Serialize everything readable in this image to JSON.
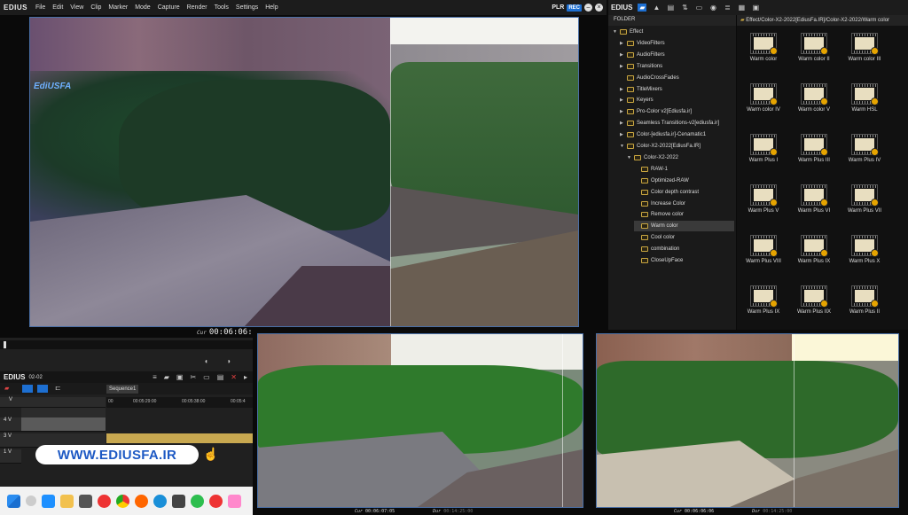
{
  "menubar": {
    "logo": "EDIUS",
    "menus": [
      "File",
      "Edit",
      "View",
      "Clip",
      "Marker",
      "Mode",
      "Capture",
      "Render",
      "Tools",
      "Settings",
      "Help"
    ],
    "plr": "PLR",
    "rec": "REC"
  },
  "preview": {
    "watermark": "EdiUSFA",
    "cur_label": "Cur",
    "cur_time": "00:06:06:"
  },
  "bin": {
    "logo": "EDIUS",
    "folder_label": "FOLDER",
    "path": "Effect/Color-X2-2022[EdiusFa.IR]/Color-X2-2022/Warm color",
    "tree": [
      {
        "label": "Effect",
        "level": 0,
        "arrow": "▼"
      },
      {
        "label": "VideoFilters",
        "level": 1,
        "arrow": "▶"
      },
      {
        "label": "AudioFilters",
        "level": 1,
        "arrow": "▶"
      },
      {
        "label": "Transitions",
        "level": 1,
        "arrow": "▶"
      },
      {
        "label": "AudioCrossFades",
        "level": 1,
        "arrow": ""
      },
      {
        "label": "TitleMixers",
        "level": 1,
        "arrow": "▶"
      },
      {
        "label": "Keyers",
        "level": 1,
        "arrow": "▶"
      },
      {
        "label": "Pro-Color v2[Ediusfa.ir]",
        "level": 1,
        "arrow": "▶"
      },
      {
        "label": "Seamless Transitions-v2[ediusfa.ir]",
        "level": 1,
        "arrow": "▶"
      },
      {
        "label": "Color-[ediusfa.ir]-Cenamatic1",
        "level": 1,
        "arrow": "▶"
      },
      {
        "label": "Color-X2-2022[EdiusFa.IR]",
        "level": 1,
        "arrow": "▼"
      },
      {
        "label": "Color-X2-2022",
        "level": 2,
        "arrow": "▼"
      },
      {
        "label": "RAW-1",
        "level": 3,
        "arrow": ""
      },
      {
        "label": "Optimized-RAW",
        "level": 3,
        "arrow": ""
      },
      {
        "label": "Color depth contrast",
        "level": 3,
        "arrow": ""
      },
      {
        "label": "Increase Color",
        "level": 3,
        "arrow": ""
      },
      {
        "label": "Remove color",
        "level": 3,
        "arrow": ""
      },
      {
        "label": "Warm color",
        "level": 3,
        "arrow": "",
        "selected": true
      },
      {
        "label": "Cool color",
        "level": 3,
        "arrow": ""
      },
      {
        "label": "combination",
        "level": 3,
        "arrow": ""
      },
      {
        "label": "CloseUpFace",
        "level": 3,
        "arrow": ""
      }
    ],
    "clips": [
      "Warm color",
      "Warm color II",
      "Warm color III",
      "Warm color IV",
      "Warm color V",
      "Warm HSL",
      "Warm Plus I",
      "Warm Plus III",
      "Warm Plus IV",
      "Warm Plus V",
      "Warm Plus VI",
      "Warm Plus VII",
      "Warm Plus VIII",
      "Warm Plus IX",
      "Warm Plus X",
      "Warm Plus IX",
      "Warm Plus IIX",
      "Warm Plus II"
    ]
  },
  "timeline": {
    "logo": "EDIUS",
    "project": "02-02",
    "sequence_tab": "Sequence1",
    "ruler": [
      "00",
      "00:05:29:00",
      "00:05:38:00",
      "00:05:4"
    ],
    "tracks": [
      {
        "label": "V",
        "type": "v"
      },
      {
        "label": "4 V",
        "type": "v"
      },
      {
        "label": "3 V",
        "type": "v"
      },
      {
        "label": "1 V",
        "type": "v"
      }
    ]
  },
  "banner": "WWW.EDIUSFA.IR",
  "monitors": {
    "left_cur": "00:06:07:05",
    "left_dur": "00:14:25:00",
    "right_cur": "00:06:06:06",
    "right_dur": "00:14:25:00",
    "cur_label": "Cur",
    "dur_label": "Dur"
  },
  "colors": {
    "accent": "#1d6fd1",
    "selection": "#3a3a3a",
    "badge": "#e6a400",
    "track_clip": "#c8a850"
  }
}
